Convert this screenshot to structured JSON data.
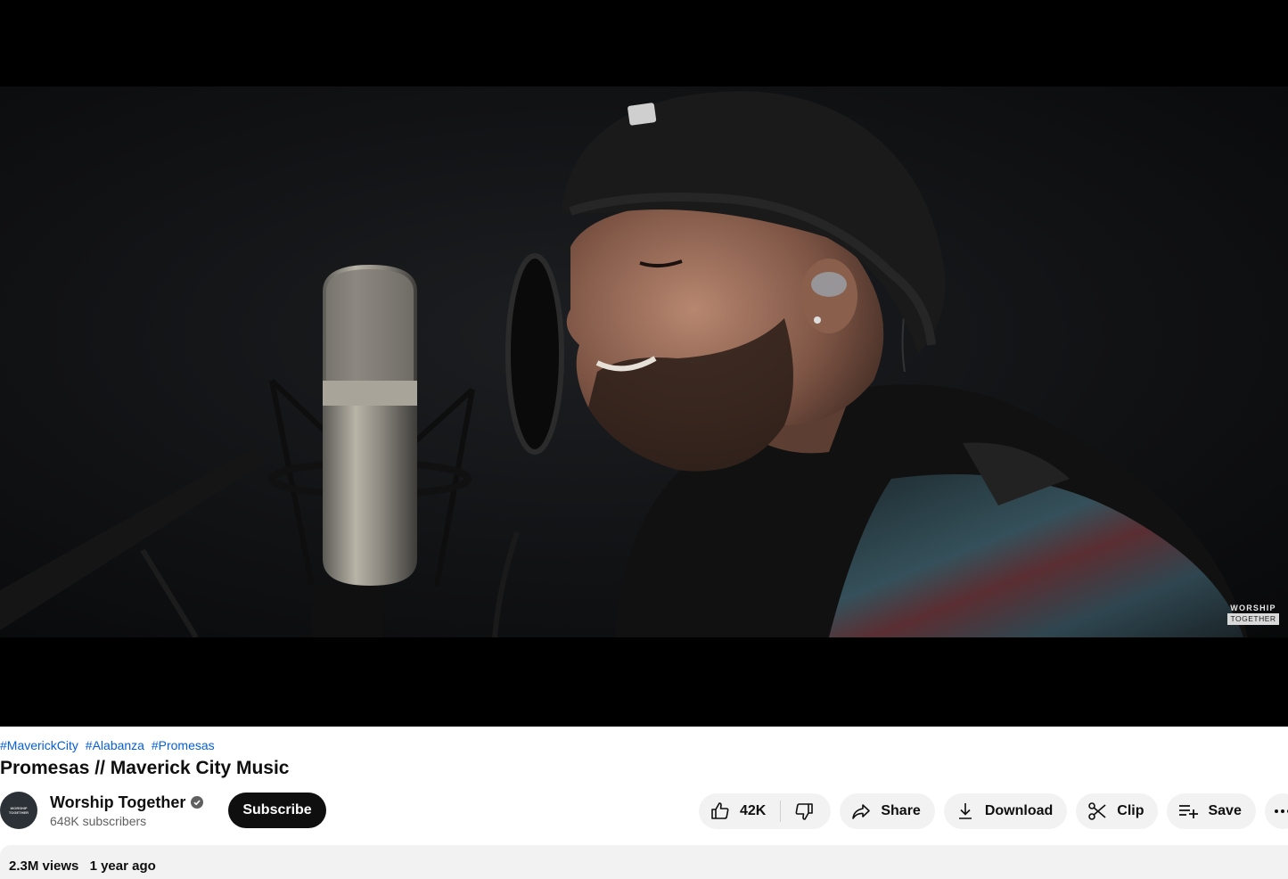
{
  "player": {
    "watermark_top": "WORSHIP",
    "watermark_bottom": "TOGETHER"
  },
  "video": {
    "hashtags": [
      "#MaverickCity",
      "#Alabanza",
      "#Promesas"
    ],
    "title": "Promesas // Maverick City Music"
  },
  "channel": {
    "name": "Worship Together",
    "subscribers": "648K subscribers",
    "avatar_text": "WORSHIP TOGETHER",
    "verified": true
  },
  "buttons": {
    "subscribe": "Subscribe",
    "like_count": "42K",
    "share": "Share",
    "download": "Download",
    "clip": "Clip",
    "save": "Save"
  },
  "description": {
    "views": "2.3M views",
    "age": "1 year ago"
  },
  "colors": {
    "hashtag": "#065fd4",
    "subscribe_bg": "#0f0f0f",
    "pill_bg": "#f2f2f2"
  },
  "icons": [
    "like-icon",
    "dislike-icon",
    "share-icon",
    "download-icon",
    "clip-icon",
    "save-icon",
    "more-icon",
    "verified-icon"
  ]
}
